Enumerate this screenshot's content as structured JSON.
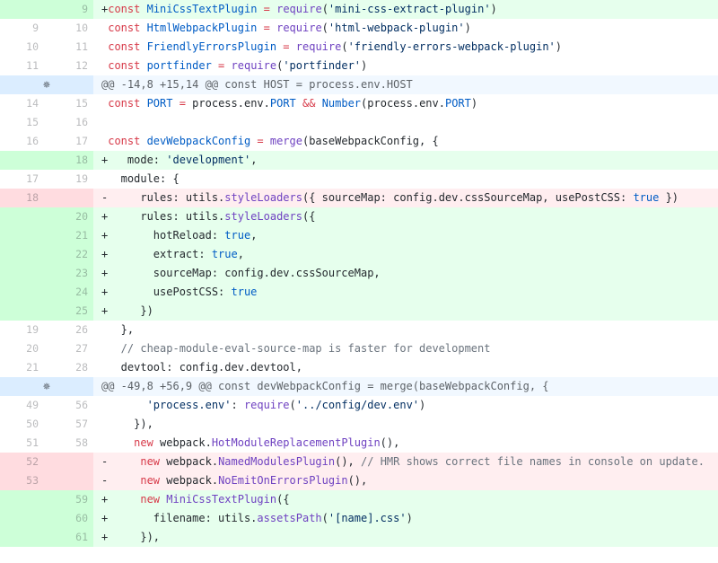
{
  "colors": {
    "added_line_bg": "#e6ffed",
    "added_num_bg": "#cdffd8",
    "deleted_line_bg": "#ffeef0",
    "deleted_num_bg": "#ffdce0",
    "hunk_bg": "#f1f8ff",
    "hunk_expand_bg": "#dbedff"
  },
  "expand_icon": "unfold-icon",
  "lines": [
    {
      "type": "add",
      "old": "",
      "new": "9",
      "tokens": [
        [
          "",
          "+"
        ],
        [
          "k",
          "const "
        ],
        [
          "c",
          "MiniCssTextPlugin"
        ],
        [
          "k",
          " = "
        ],
        [
          "f",
          "require"
        ],
        [
          "v",
          "("
        ],
        [
          "s",
          "'mini-css-extract-plugin'"
        ],
        [
          "v",
          ")"
        ]
      ]
    },
    {
      "type": "ctx",
      "old": "9",
      "new": "10",
      "tokens": [
        [
          "",
          ""
        ],
        [
          "k",
          " const "
        ],
        [
          "c",
          "HtmlWebpackPlugin"
        ],
        [
          "k",
          " = "
        ],
        [
          "f",
          "require"
        ],
        [
          "v",
          "("
        ],
        [
          "s",
          "'html-webpack-plugin'"
        ],
        [
          "v",
          ")"
        ]
      ]
    },
    {
      "type": "ctx",
      "old": "10",
      "new": "11",
      "tokens": [
        [
          "",
          ""
        ],
        [
          "k",
          " const "
        ],
        [
          "c",
          "FriendlyErrorsPlugin"
        ],
        [
          "k",
          " = "
        ],
        [
          "f",
          "require"
        ],
        [
          "v",
          "("
        ],
        [
          "s",
          "'friendly-errors-webpack-plugin'"
        ],
        [
          "v",
          ")"
        ]
      ]
    },
    {
      "type": "ctx",
      "old": "11",
      "new": "12",
      "tokens": [
        [
          "",
          ""
        ],
        [
          "k",
          " const "
        ],
        [
          "c",
          "portfinder"
        ],
        [
          "k",
          " = "
        ],
        [
          "f",
          "require"
        ],
        [
          "v",
          "("
        ],
        [
          "s",
          "'portfinder'"
        ],
        [
          "v",
          ")"
        ]
      ]
    },
    {
      "type": "hunk",
      "text": "@@ -14,8 +15,14 @@ const HOST = process.env.HOST"
    },
    {
      "type": "ctx",
      "old": "14",
      "new": "15",
      "tokens": [
        [
          "",
          ""
        ],
        [
          "k",
          " const "
        ],
        [
          "c",
          "PORT"
        ],
        [
          "k",
          " = "
        ],
        [
          "v",
          "process.env."
        ],
        [
          "c",
          "PORT"
        ],
        [
          "k",
          " && "
        ],
        [
          "c",
          "Number"
        ],
        [
          "v",
          "(process.env."
        ],
        [
          "c",
          "PORT"
        ],
        [
          "v",
          ")"
        ]
      ]
    },
    {
      "type": "ctx",
      "old": "15",
      "new": "16",
      "tokens": [
        [
          "",
          ""
        ]
      ]
    },
    {
      "type": "ctx",
      "old": "16",
      "new": "17",
      "tokens": [
        [
          "",
          ""
        ],
        [
          "k",
          " const "
        ],
        [
          "c",
          "devWebpackConfig"
        ],
        [
          "k",
          " = "
        ],
        [
          "f",
          "merge"
        ],
        [
          "v",
          "(baseWebpackConfig, {"
        ]
      ]
    },
    {
      "type": "add",
      "old": "",
      "new": "18",
      "tokens": [
        [
          "",
          "+   "
        ],
        [
          "v",
          "mode: "
        ],
        [
          "s",
          "'development'"
        ],
        [
          "v",
          ","
        ]
      ]
    },
    {
      "type": "ctx",
      "old": "17",
      "new": "19",
      "tokens": [
        [
          "",
          ""
        ],
        [
          "v",
          "   module: {"
        ]
      ]
    },
    {
      "type": "del",
      "old": "18",
      "new": "",
      "tokens": [
        [
          "",
          "-     "
        ],
        [
          "v",
          "rules: utils."
        ],
        [
          "f",
          "styleLoaders"
        ],
        [
          "v",
          "({ sourceMap: config.dev.cssSourceMap, usePostCSS: "
        ],
        [
          "c",
          "true"
        ],
        [
          "v",
          " })"
        ]
      ]
    },
    {
      "type": "add",
      "old": "",
      "new": "20",
      "tokens": [
        [
          "",
          "+     "
        ],
        [
          "v",
          "rules: utils."
        ],
        [
          "f",
          "styleLoaders"
        ],
        [
          "v",
          "({"
        ]
      ]
    },
    {
      "type": "add",
      "old": "",
      "new": "21",
      "tokens": [
        [
          "",
          "+       "
        ],
        [
          "v",
          "hotReload: "
        ],
        [
          "c",
          "true"
        ],
        [
          "v",
          ","
        ]
      ]
    },
    {
      "type": "add",
      "old": "",
      "new": "22",
      "tokens": [
        [
          "",
          "+       "
        ],
        [
          "v",
          "extract: "
        ],
        [
          "c",
          "true"
        ],
        [
          "v",
          ","
        ]
      ]
    },
    {
      "type": "add",
      "old": "",
      "new": "23",
      "tokens": [
        [
          "",
          "+       "
        ],
        [
          "v",
          "sourceMap: config.dev.cssSourceMap,"
        ]
      ]
    },
    {
      "type": "add",
      "old": "",
      "new": "24",
      "tokens": [
        [
          "",
          "+       "
        ],
        [
          "v",
          "usePostCSS: "
        ],
        [
          "c",
          "true"
        ]
      ]
    },
    {
      "type": "add",
      "old": "",
      "new": "25",
      "tokens": [
        [
          "",
          "+     "
        ],
        [
          "v",
          "})"
        ]
      ]
    },
    {
      "type": "ctx",
      "old": "19",
      "new": "26",
      "tokens": [
        [
          "",
          ""
        ],
        [
          "v",
          "   },"
        ]
      ]
    },
    {
      "type": "ctx",
      "old": "20",
      "new": "27",
      "tokens": [
        [
          "",
          ""
        ],
        [
          "cm",
          "   // cheap-module-eval-source-map is faster for development"
        ]
      ]
    },
    {
      "type": "ctx",
      "old": "21",
      "new": "28",
      "tokens": [
        [
          "",
          ""
        ],
        [
          "v",
          "   devtool: config.dev.devtool,"
        ]
      ]
    },
    {
      "type": "hunk",
      "text": "@@ -49,8 +56,9 @@ const devWebpackConfig = merge(baseWebpackConfig, {"
    },
    {
      "type": "ctx",
      "old": "49",
      "new": "56",
      "tokens": [
        [
          "",
          ""
        ],
        [
          "s",
          "       'process.env'"
        ],
        [
          "v",
          ": "
        ],
        [
          "f",
          "require"
        ],
        [
          "v",
          "("
        ],
        [
          "s",
          "'../config/dev.env'"
        ],
        [
          "v",
          ")"
        ]
      ]
    },
    {
      "type": "ctx",
      "old": "50",
      "new": "57",
      "tokens": [
        [
          "",
          ""
        ],
        [
          "v",
          "     }),"
        ]
      ]
    },
    {
      "type": "ctx",
      "old": "51",
      "new": "58",
      "tokens": [
        [
          "",
          ""
        ],
        [
          "k",
          "     new "
        ],
        [
          "v",
          "webpack."
        ],
        [
          "f",
          "HotModuleReplacementPlugin"
        ],
        [
          "v",
          "(),"
        ]
      ]
    },
    {
      "type": "del",
      "old": "52",
      "new": "",
      "tokens": [
        [
          "",
          "-     "
        ],
        [
          "k",
          "new "
        ],
        [
          "v",
          "webpack."
        ],
        [
          "f",
          "NamedModulesPlugin"
        ],
        [
          "v",
          "(), "
        ],
        [
          "cm",
          "// HMR shows correct file names in console on update."
        ]
      ]
    },
    {
      "type": "del",
      "old": "53",
      "new": "",
      "tokens": [
        [
          "",
          "-     "
        ],
        [
          "k",
          "new "
        ],
        [
          "v",
          "webpack."
        ],
        [
          "f",
          "NoEmitOnErrorsPlugin"
        ],
        [
          "v",
          "(),"
        ]
      ]
    },
    {
      "type": "add",
      "old": "",
      "new": "59",
      "tokens": [
        [
          "",
          "+     "
        ],
        [
          "k",
          "new "
        ],
        [
          "f",
          "MiniCssTextPlugin"
        ],
        [
          "v",
          "({"
        ]
      ]
    },
    {
      "type": "add",
      "old": "",
      "new": "60",
      "tokens": [
        [
          "",
          "+       "
        ],
        [
          "v",
          "filename: utils."
        ],
        [
          "f",
          "assetsPath"
        ],
        [
          "v",
          "("
        ],
        [
          "s",
          "'[name].css'"
        ],
        [
          "v",
          ")"
        ]
      ]
    },
    {
      "type": "add",
      "old": "",
      "new": "61",
      "tokens": [
        [
          "",
          "+     "
        ],
        [
          "v",
          "}),"
        ]
      ]
    }
  ]
}
